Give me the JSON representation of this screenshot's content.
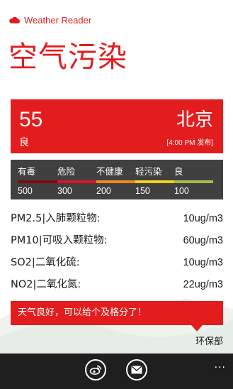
{
  "app": {
    "title": "Weather Reader"
  },
  "page": {
    "title": "空气污染"
  },
  "aqi": {
    "value": "55",
    "level": "良",
    "city": "北京",
    "published": "[4:00 PM 发布]"
  },
  "scale": {
    "items": [
      {
        "name": "有毒",
        "threshold": "500",
        "color": "#7a0c12"
      },
      {
        "name": "危险",
        "threshold": "300",
        "color": "#d8132a"
      },
      {
        "name": "不健康",
        "threshold": "200",
        "color": "#f0861e"
      },
      {
        "name": "轻污染",
        "threshold": "150",
        "color": "#f2d21b"
      },
      {
        "name": "良",
        "threshold": "100",
        "color": "#a9b84a"
      }
    ]
  },
  "pollutants": [
    {
      "name": "PM2.5|入肺颗粒物:",
      "value": "10ug/m3"
    },
    {
      "name": "PM10|可吸入颗粒物:",
      "value": "60ug/m3"
    },
    {
      "name": "SO2|二氧化硫:",
      "value": "10ug/m3"
    },
    {
      "name": "NO2|二氧化氮:",
      "value": "22ug/m3"
    }
  ],
  "advice": {
    "text": "天气良好，可以给个及格分了！"
  },
  "source": {
    "text": "环保部"
  },
  "app_bar": {
    "buttons": [
      {
        "icon": "weibo-icon"
      },
      {
        "icon": "mail-icon"
      }
    ],
    "more": "..."
  },
  "colors": {
    "accent": "#e31d1d",
    "panel": "#404040",
    "app_bar": "#1f1f1f"
  }
}
